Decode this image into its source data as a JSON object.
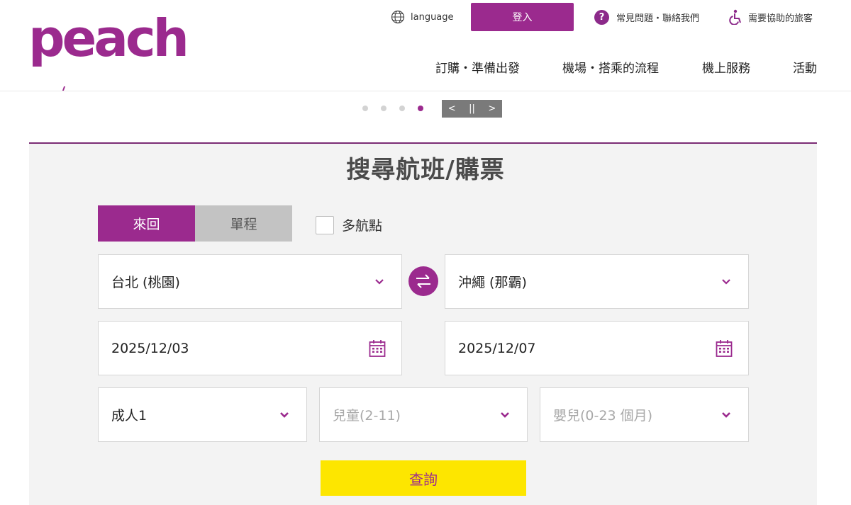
{
  "brand": {
    "logo_text": "peach",
    "accent": "#9b2a8e",
    "cta_color": "#fde600"
  },
  "header": {
    "language_label": "language",
    "login_label": "登入",
    "faq_label": "常見問題・聯絡我們",
    "assist_label": "需要協助的旅客",
    "nav": [
      {
        "label": "訂購・準備出發"
      },
      {
        "label": "機場・搭乘的流程"
      },
      {
        "label": "機上服務"
      },
      {
        "label": "活動"
      }
    ]
  },
  "carousel": {
    "slide_count": 4,
    "active_slide": 4,
    "prev_glyph": "<",
    "pause_glyph": "||",
    "next_glyph": ">"
  },
  "search": {
    "title": "搜尋航班/購票",
    "trip_types": [
      {
        "label": "來回",
        "active": true
      },
      {
        "label": "單程",
        "active": false
      }
    ],
    "multi_city_label": "多航點",
    "multi_city_checked": false,
    "origin": "台北 (桃園)",
    "destination": "沖繩 (那霸)",
    "depart_date": "2025/12/03",
    "return_date": "2025/12/07",
    "adults": "成人1",
    "children_placeholder": "兒童(2-11)",
    "infants_placeholder": "嬰兒(0-23 個月)",
    "submit_label": "查詢"
  },
  "icons": {
    "language": "globe-icon",
    "faq": "question-circle-icon",
    "assist": "wheelchair-icon",
    "dropdown": "chevron-down-icon",
    "calendar": "calendar-icon",
    "swap": "swap-arrows-icon"
  }
}
